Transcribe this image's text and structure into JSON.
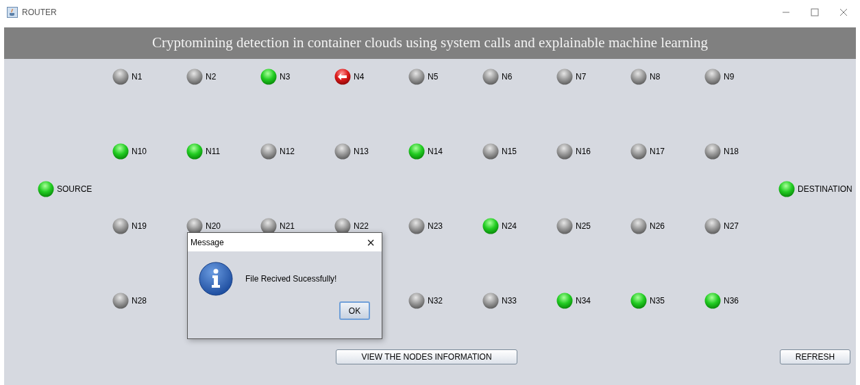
{
  "window": {
    "title": "ROUTER"
  },
  "header": {
    "title": "Cryptomining detection in container clouds using system calls and explainable machine learning"
  },
  "source": {
    "label": "SOURCE",
    "kind": "active"
  },
  "destination": {
    "label": "DESTINATION",
    "kind": "active"
  },
  "node_rows": [
    [
      {
        "label": "N1",
        "kind": "idle"
      },
      {
        "label": "N2",
        "kind": "idle"
      },
      {
        "label": "N3",
        "kind": "active"
      },
      {
        "label": "N4",
        "kind": "alert"
      },
      {
        "label": "N5",
        "kind": "idle"
      },
      {
        "label": "N6",
        "kind": "idle"
      },
      {
        "label": "N7",
        "kind": "idle"
      },
      {
        "label": "N8",
        "kind": "idle"
      },
      {
        "label": "N9",
        "kind": "idle"
      }
    ],
    [
      {
        "label": "N10",
        "kind": "active"
      },
      {
        "label": "N11",
        "kind": "active"
      },
      {
        "label": "N12",
        "kind": "idle"
      },
      {
        "label": "N13",
        "kind": "idle"
      },
      {
        "label": "N14",
        "kind": "active"
      },
      {
        "label": "N15",
        "kind": "idle"
      },
      {
        "label": "N16",
        "kind": "idle"
      },
      {
        "label": "N17",
        "kind": "idle"
      },
      {
        "label": "N18",
        "kind": "idle"
      }
    ],
    [
      {
        "label": "N19",
        "kind": "idle"
      },
      {
        "label": "N20",
        "kind": "idle"
      },
      {
        "label": "N21",
        "kind": "idle"
      },
      {
        "label": "N22",
        "kind": "idle"
      },
      {
        "label": "N23",
        "kind": "idle"
      },
      {
        "label": "N24",
        "kind": "active"
      },
      {
        "label": "N25",
        "kind": "idle"
      },
      {
        "label": "N26",
        "kind": "idle"
      },
      {
        "label": "N27",
        "kind": "idle"
      }
    ],
    [
      {
        "label": "N28",
        "kind": "idle"
      },
      {
        "label": "N32",
        "kind": "idle"
      },
      {
        "label": "N33",
        "kind": "idle"
      },
      {
        "label": "N34",
        "kind": "active"
      },
      {
        "label": "N35",
        "kind": "active"
      },
      {
        "label": "N36",
        "kind": "active"
      }
    ]
  ],
  "buttons": {
    "view": "VIEW THE NODES INFORMATION",
    "refresh": "REFRESH"
  },
  "dialog": {
    "title": "Message",
    "close": "×",
    "message": "File Recived Sucessfully!",
    "ok": "OK"
  }
}
